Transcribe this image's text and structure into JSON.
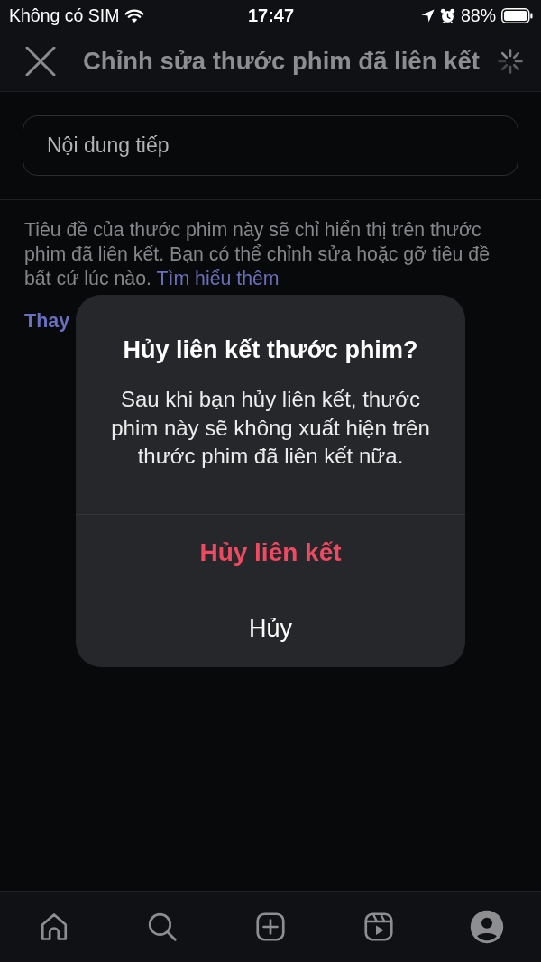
{
  "status_bar": {
    "carrier": "Không có SIM",
    "time": "17:47",
    "battery": "88%"
  },
  "header": {
    "title": "Chỉnh sửa thước phim đã liên kết"
  },
  "title_field": {
    "value": "Nội dung tiếp"
  },
  "description": {
    "text": "Tiêu đề của thước phim này sẽ chỉ hiển thị trên thước phim đã liên kết. Bạn có thể chỉnh sửa hoặc gỡ tiêu đề bất cứ lúc nào.",
    "link": "Tìm hiểu thêm"
  },
  "action_link": "Thay",
  "dialog": {
    "title": "Hủy liên kết thước phim?",
    "message": "Sau khi bạn hủy liên kết, thước phim này sẽ không xuất hiện trên thước phim đã liên kết nữa.",
    "actions": [
      {
        "label": "Hủy liên kết",
        "kind": "destructive"
      },
      {
        "label": "Hủy",
        "kind": "cancel"
      }
    ]
  }
}
